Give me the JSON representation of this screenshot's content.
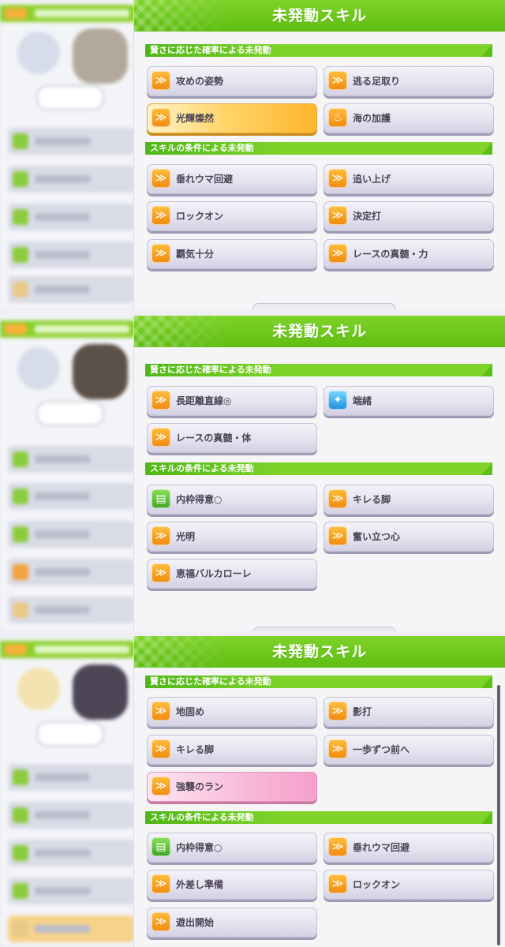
{
  "colors": {
    "accent_green": "#6cc31d",
    "skill_gold": "#ffc545",
    "skill_pink": "#f7add2"
  },
  "screens": [
    {
      "title": "未発動スキル",
      "sections": [
        {
          "label": "賢さに応じた確率による未発動",
          "skills": [
            {
              "name": "攻めの姿勢",
              "icon": "speed-skill-icon"
            },
            {
              "name": "逃る足取り",
              "icon": "speed-skill-icon"
            },
            {
              "name": "光輝燦然",
              "icon": "speed-skill-icon",
              "highlight": "gold"
            },
            {
              "name": "海の加護",
              "icon": "recovery-skill-icon"
            }
          ]
        },
        {
          "label": "スキルの条件による未発動",
          "skills": [
            {
              "name": "垂れウマ回避",
              "icon": "speed-skill-icon"
            },
            {
              "name": "追い上げ",
              "icon": "speed-skill-icon"
            },
            {
              "name": "ロックオン",
              "icon": "speed-skill-icon"
            },
            {
              "name": "決定打",
              "icon": "speed-skill-icon"
            },
            {
              "name": "覇気十分",
              "icon": "speed-skill-icon"
            },
            {
              "name": "レースの真髄・力",
              "icon": "speed-skill-icon"
            }
          ]
        }
      ]
    },
    {
      "title": "未発動スキル",
      "sections": [
        {
          "label": "賢さに応じた確率による未発動",
          "skills": [
            {
              "name": "長距離直線◎",
              "icon": "speed-skill-icon"
            },
            {
              "name": "端緒",
              "icon": "blue-skill-icon"
            },
            {
              "name": "レースの真髄・体",
              "icon": "speed-skill-icon"
            }
          ]
        },
        {
          "label": "スキルの条件による未発動",
          "skills": [
            {
              "name": "内枠得意○",
              "icon": "green-skill-icon"
            },
            {
              "name": "キレる脚",
              "icon": "speed-skill-icon"
            },
            {
              "name": "光明",
              "icon": "speed-skill-icon"
            },
            {
              "name": "奮い立つ心",
              "icon": "speed-skill-icon"
            },
            {
              "name": "恵福バルカローレ",
              "icon": "speed-skill-icon"
            }
          ]
        }
      ]
    },
    {
      "title": "未発動スキル",
      "sections": [
        {
          "label": "賢さに応じた確率による未発動",
          "skills": [
            {
              "name": "地固め",
              "icon": "speed-skill-icon"
            },
            {
              "name": "影打",
              "icon": "speed-skill-icon"
            },
            {
              "name": "キレる脚",
              "icon": "speed-skill-icon"
            },
            {
              "name": "一歩ずつ前へ",
              "icon": "speed-skill-icon"
            },
            {
              "name": "強襲のラン",
              "icon": "speed-skill-icon",
              "highlight": "pink"
            }
          ]
        },
        {
          "label": "スキルの条件による未発動",
          "skills": [
            {
              "name": "内枠得意○",
              "icon": "green-skill-icon"
            },
            {
              "name": "垂れウマ回避",
              "icon": "speed-skill-icon"
            },
            {
              "name": "外差し準備",
              "icon": "speed-skill-icon"
            },
            {
              "name": "ロックオン",
              "icon": "speed-skill-icon"
            },
            {
              "name": "遊出開始",
              "icon": "speed-skill-icon"
            }
          ]
        }
      ]
    }
  ]
}
